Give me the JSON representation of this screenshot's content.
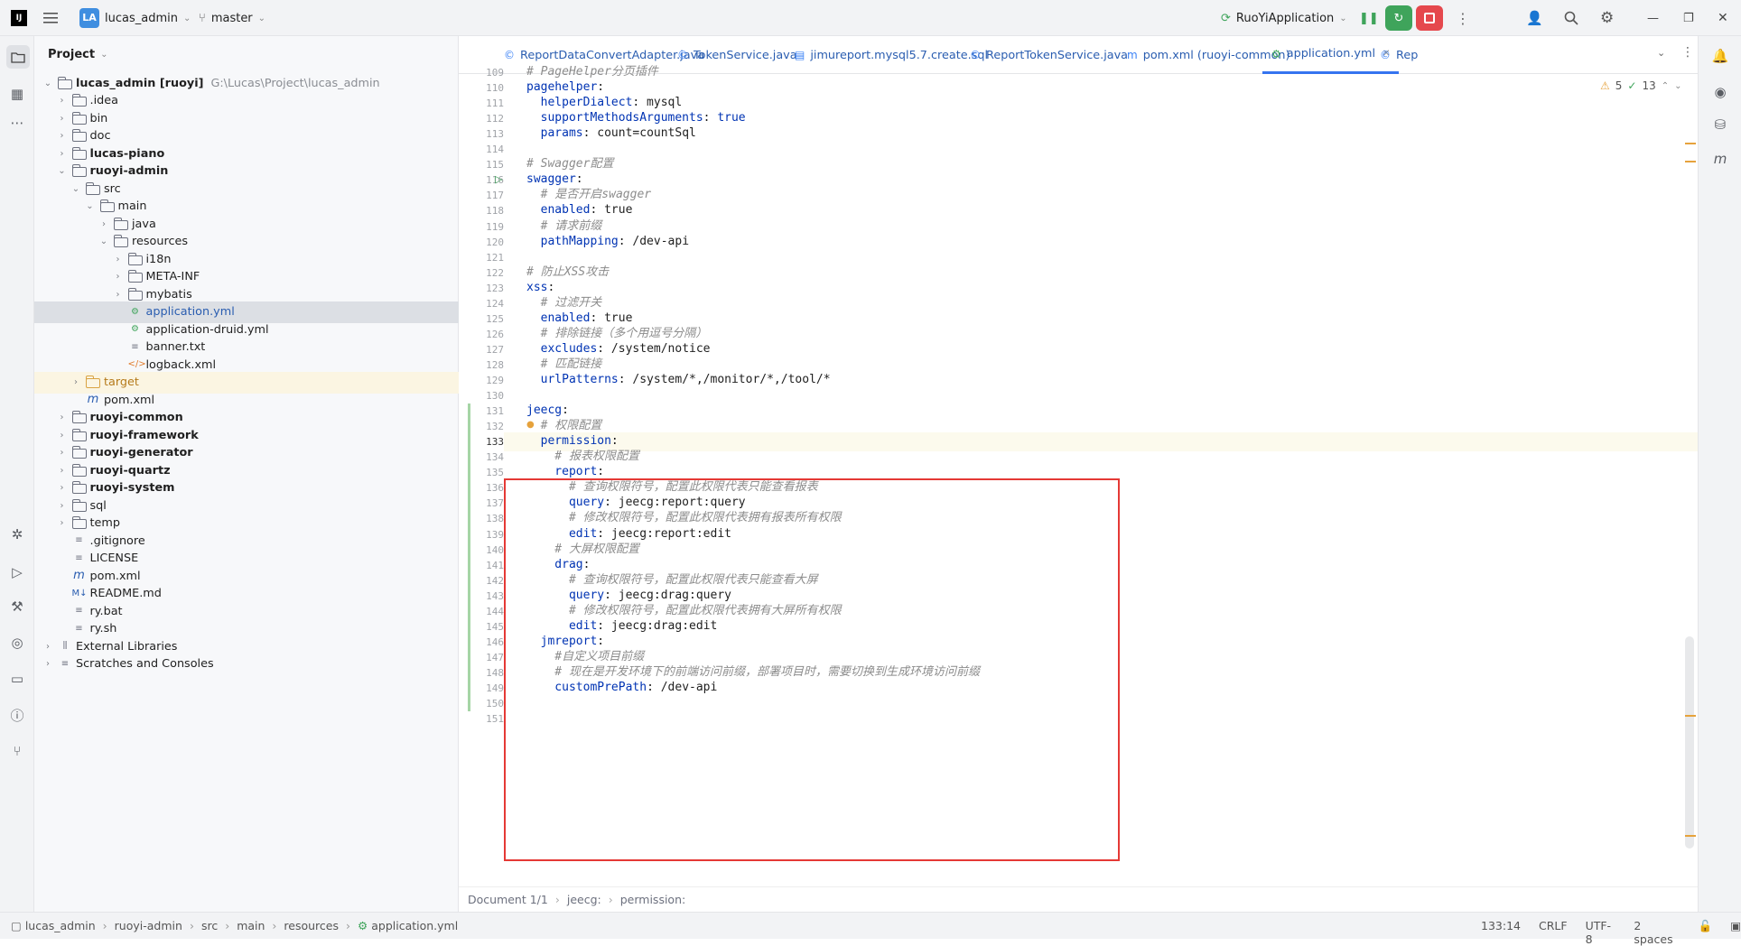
{
  "titlebar": {
    "project_badge": "LA",
    "project_name": "lucas_admin",
    "branch": "master",
    "run_config": "RuoYiApplication"
  },
  "project_panel": {
    "title": "Project",
    "tree": [
      {
        "label": "lucas_admin [ruoyi]",
        "extra": "G:\\Lucas\\Project\\lucas_admin",
        "depth": 0,
        "type": "module",
        "bold": true
      },
      {
        "label": ".idea",
        "depth": 1,
        "type": "folder"
      },
      {
        "label": "bin",
        "depth": 1,
        "type": "folder"
      },
      {
        "label": "doc",
        "depth": 1,
        "type": "folder"
      },
      {
        "label": "lucas-piano",
        "depth": 1,
        "type": "module",
        "bold": true
      },
      {
        "label": "ruoyi-admin",
        "depth": 1,
        "type": "module",
        "bold": true
      },
      {
        "label": "src",
        "depth": 2,
        "type": "folder"
      },
      {
        "label": "main",
        "depth": 3,
        "type": "folder"
      },
      {
        "label": "java",
        "depth": 4,
        "type": "folder"
      },
      {
        "label": "resources",
        "depth": 4,
        "type": "folder"
      },
      {
        "label": "i18n",
        "depth": 5,
        "type": "folder"
      },
      {
        "label": "META-INF",
        "depth": 5,
        "type": "folder"
      },
      {
        "label": "mybatis",
        "depth": 5,
        "type": "folder"
      },
      {
        "label": "application.yml",
        "depth": 5,
        "type": "yml",
        "selected": true
      },
      {
        "label": "application-druid.yml",
        "depth": 5,
        "type": "yml"
      },
      {
        "label": "banner.txt",
        "depth": 5,
        "type": "txt"
      },
      {
        "label": "logback.xml",
        "depth": 5,
        "type": "xml"
      },
      {
        "label": "target",
        "depth": 2,
        "type": "folder-orange",
        "highlight": true
      },
      {
        "label": "pom.xml",
        "depth": 2,
        "type": "maven"
      },
      {
        "label": "ruoyi-common",
        "depth": 1,
        "type": "module",
        "bold": true
      },
      {
        "label": "ruoyi-framework",
        "depth": 1,
        "type": "module",
        "bold": true
      },
      {
        "label": "ruoyi-generator",
        "depth": 1,
        "type": "module",
        "bold": true
      },
      {
        "label": "ruoyi-quartz",
        "depth": 1,
        "type": "module",
        "bold": true
      },
      {
        "label": "ruoyi-system",
        "depth": 1,
        "type": "module",
        "bold": true
      },
      {
        "label": "sql",
        "depth": 1,
        "type": "folder"
      },
      {
        "label": "temp",
        "depth": 1,
        "type": "folder"
      },
      {
        "label": ".gitignore",
        "depth": 1,
        "type": "txt"
      },
      {
        "label": "LICENSE",
        "depth": 1,
        "type": "txt"
      },
      {
        "label": "pom.xml",
        "depth": 1,
        "type": "maven"
      },
      {
        "label": "README.md",
        "depth": 1,
        "type": "md"
      },
      {
        "label": "ry.bat",
        "depth": 1,
        "type": "txt"
      },
      {
        "label": "ry.sh",
        "depth": 1,
        "type": "txt"
      },
      {
        "label": "External Libraries",
        "depth": 0,
        "type": "lib"
      },
      {
        "label": "Scratches and Consoles",
        "depth": 0,
        "type": "scratch"
      }
    ]
  },
  "tabs": [
    {
      "label": "ReportDataConvertAdapter.java",
      "icon": "©"
    },
    {
      "label": "TokenService.java",
      "icon": "©"
    },
    {
      "label": "jimureport.mysql5.7.create.sql",
      "icon": "▤"
    },
    {
      "label": "ReportTokenService.java",
      "icon": "©"
    },
    {
      "label": "pom.xml (ruoyi-common)",
      "icon": "m"
    },
    {
      "label": "application.yml",
      "icon": "⚙",
      "active": true
    },
    {
      "label": "Rep",
      "icon": "©"
    }
  ],
  "inspections": {
    "warnings": "5",
    "checks": "13"
  },
  "code_lines": [
    {
      "n": "109",
      "parts": [
        {
          "t": "# PageHelper分页插件",
          "c": "c"
        }
      ]
    },
    {
      "n": "110",
      "parts": [
        {
          "t": "pagehelper",
          "c": "k"
        },
        {
          "t": ":",
          "c": ""
        }
      ]
    },
    {
      "n": "111",
      "parts": [
        {
          "t": "  helperDialect",
          "c": "k"
        },
        {
          "t": ": mysql",
          "c": ""
        }
      ]
    },
    {
      "n": "112",
      "parts": [
        {
          "t": "  supportMethodsArguments",
          "c": "k"
        },
        {
          "t": ": ",
          "c": ""
        },
        {
          "t": "true",
          "c": "kw"
        }
      ]
    },
    {
      "n": "113",
      "parts": [
        {
          "t": "  params",
          "c": "k"
        },
        {
          "t": ": count=countSql",
          "c": ""
        }
      ]
    },
    {
      "n": "114",
      "parts": []
    },
    {
      "n": "115",
      "parts": [
        {
          "t": "# Swagger配置",
          "c": "c"
        }
      ]
    },
    {
      "n": "116",
      "parts": [
        {
          "t": "swagger",
          "c": "k"
        },
        {
          "t": ":",
          "c": ""
        }
      ]
    },
    {
      "n": "117",
      "parts": [
        {
          "t": "  # 是否开启swagger",
          "c": "c"
        }
      ]
    },
    {
      "n": "118",
      "parts": [
        {
          "t": "  enabled",
          "c": "k"
        },
        {
          "t": ": true",
          "c": ""
        }
      ]
    },
    {
      "n": "119",
      "parts": [
        {
          "t": "  # 请求前缀",
          "c": "c"
        }
      ]
    },
    {
      "n": "120",
      "parts": [
        {
          "t": "  pathMapping",
          "c": "k"
        },
        {
          "t": ": /dev-api",
          "c": ""
        }
      ]
    },
    {
      "n": "121",
      "parts": []
    },
    {
      "n": "122",
      "parts": [
        {
          "t": "# 防止XSS攻击",
          "c": "c"
        }
      ]
    },
    {
      "n": "123",
      "parts": [
        {
          "t": "xss",
          "c": "k"
        },
        {
          "t": ":",
          "c": ""
        }
      ]
    },
    {
      "n": "124",
      "parts": [
        {
          "t": "  # 过滤开关",
          "c": "c"
        }
      ]
    },
    {
      "n": "125",
      "parts": [
        {
          "t": "  enabled",
          "c": "k"
        },
        {
          "t": ": true",
          "c": ""
        }
      ]
    },
    {
      "n": "126",
      "parts": [
        {
          "t": "  # 排除链接（多个用逗号分隔）",
          "c": "c"
        }
      ]
    },
    {
      "n": "127",
      "parts": [
        {
          "t": "  excludes",
          "c": "k"
        },
        {
          "t": ": /system/notice",
          "c": ""
        }
      ]
    },
    {
      "n": "128",
      "parts": [
        {
          "t": "  # 匹配链接",
          "c": "c"
        }
      ]
    },
    {
      "n": "129",
      "parts": [
        {
          "t": "  urlPatterns",
          "c": "k"
        },
        {
          "t": ": /system/*,/monitor/*,/tool/*",
          "c": ""
        }
      ]
    },
    {
      "n": "130",
      "parts": []
    },
    {
      "n": "131",
      "parts": [
        {
          "t": "jeecg",
          "c": "k"
        },
        {
          "t": ":",
          "c": ""
        }
      ]
    },
    {
      "n": "132",
      "parts": [
        {
          "t": "  # 权限配置",
          "c": "c"
        }
      ]
    },
    {
      "n": "133",
      "parts": [
        {
          "t": "  permission",
          "c": "k"
        },
        {
          "t": ":",
          "c": ""
        }
      ]
    },
    {
      "n": "134",
      "parts": [
        {
          "t": "    # 报表权限配置",
          "c": "c"
        }
      ]
    },
    {
      "n": "135",
      "parts": [
        {
          "t": "    report",
          "c": "k"
        },
        {
          "t": ":",
          "c": ""
        }
      ]
    },
    {
      "n": "136",
      "parts": [
        {
          "t": "      # 查询权限符号，配置此权限代表只能查看报表",
          "c": "c"
        }
      ]
    },
    {
      "n": "137",
      "parts": [
        {
          "t": "      query",
          "c": "k"
        },
        {
          "t": ": jeecg:report:query",
          "c": ""
        }
      ]
    },
    {
      "n": "138",
      "parts": [
        {
          "t": "      # 修改权限符号，配置此权限代表拥有报表所有权限",
          "c": "c"
        }
      ]
    },
    {
      "n": "139",
      "parts": [
        {
          "t": "      edit",
          "c": "k"
        },
        {
          "t": ": jeecg:report:edit",
          "c": ""
        }
      ]
    },
    {
      "n": "140",
      "parts": [
        {
          "t": "    # 大屏权限配置",
          "c": "c"
        }
      ]
    },
    {
      "n": "141",
      "parts": [
        {
          "t": "    drag",
          "c": "k"
        },
        {
          "t": ":",
          "c": ""
        }
      ]
    },
    {
      "n": "142",
      "parts": [
        {
          "t": "      # 查询权限符号，配置此权限代表只能查看大屏",
          "c": "c"
        }
      ]
    },
    {
      "n": "143",
      "parts": [
        {
          "t": "      query",
          "c": "k"
        },
        {
          "t": ": jeecg:drag:query",
          "c": ""
        }
      ]
    },
    {
      "n": "144",
      "parts": [
        {
          "t": "      # 修改权限符号，配置此权限代表拥有大屏所有权限",
          "c": "c"
        }
      ]
    },
    {
      "n": "145",
      "parts": [
        {
          "t": "      edit",
          "c": "k"
        },
        {
          "t": ": jeecg:drag:edit",
          "c": ""
        }
      ]
    },
    {
      "n": "146",
      "parts": [
        {
          "t": "  jmreport",
          "c": "k"
        },
        {
          "t": ":",
          "c": ""
        }
      ]
    },
    {
      "n": "147",
      "parts": [
        {
          "t": "    #自定义项目前缀",
          "c": "c"
        }
      ]
    },
    {
      "n": "148",
      "parts": [
        {
          "t": "    # 现在是开发环境下的前端访问前缀，部署项目时，需要切换到生成环境访问前缀",
          "c": "c"
        }
      ]
    },
    {
      "n": "149",
      "parts": [
        {
          "t": "    customPrePath",
          "c": "k"
        },
        {
          "t": ": /dev-api",
          "c": ""
        }
      ]
    },
    {
      "n": "150",
      "parts": []
    },
    {
      "n": "151",
      "parts": []
    }
  ],
  "editor_breadcrumb": {
    "doc": "Document 1/1",
    "p1": "jeecg:",
    "p2": "permission:"
  },
  "status_bar": {
    "path": [
      "lucas_admin",
      "ruoyi-admin",
      "src",
      "main",
      "resources",
      "application.yml"
    ],
    "position": "133:14",
    "line_ending": "CRLF",
    "encoding": "UTF-8",
    "indent": "2 spaces"
  },
  "colors": {
    "accent": "#3574f0",
    "highlight_box": "#e53935",
    "run_green": "#3fa45b",
    "stop_red": "#e5484d"
  }
}
